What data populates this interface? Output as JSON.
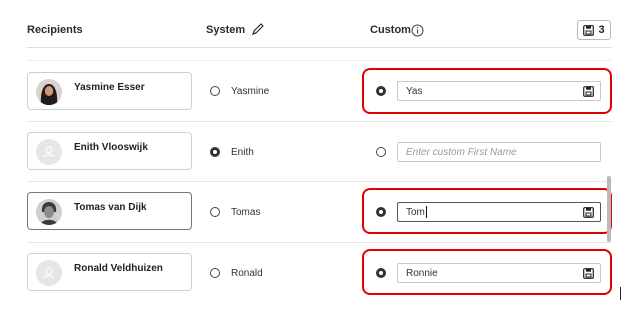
{
  "header": {
    "recipients": "Recipients",
    "system": "System",
    "custom": "Custom",
    "save_count": "3",
    "icons": {
      "system": "pencil-icon",
      "custom": "info-icon",
      "save": "floppy-disk-icon"
    }
  },
  "rows": [
    {
      "name": "Yasmine Esser",
      "system": "Yasmine",
      "custom_value": "Yas",
      "custom_placeholder": "",
      "selected": "custom",
      "avatar": "photo"
    },
    {
      "name": "Enith Vlooswijk",
      "system": "Enith",
      "custom_value": "",
      "custom_placeholder": "Enter custom First Name",
      "selected": "system",
      "avatar": "placeholder"
    },
    {
      "name": "Tomas van Dijk",
      "system": "Tomas",
      "custom_value": "Tom",
      "custom_placeholder": "",
      "selected": "custom",
      "avatar": "photo"
    },
    {
      "name": "Ronald Veldhuizen",
      "system": "Ronald",
      "custom_value": "Ronnie",
      "custom_placeholder": "",
      "selected": "custom",
      "avatar": "placeholder"
    }
  ],
  "colors": {
    "highlight": "#e00000",
    "text": "#222222",
    "border": "#c8c8c8"
  }
}
